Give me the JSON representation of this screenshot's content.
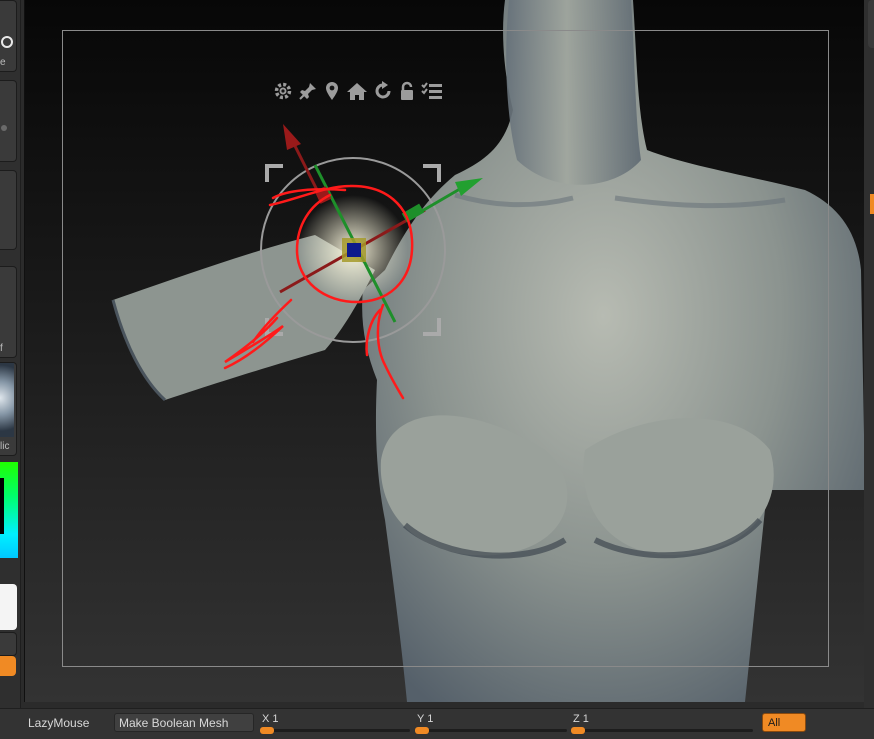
{
  "left_tray": {
    "labels": [
      "e",
      "f",
      "lic"
    ],
    "accent_color": "#f08a24"
  },
  "viewport": {
    "gizmo_toolbar": {
      "icons": [
        "gear-icon",
        "pin-icon",
        "location-marker-icon",
        "home-icon",
        "reset-rotate-icon",
        "lock-icon",
        "list-icon"
      ]
    },
    "gizmo_axes_colors": {
      "x": "#8b1a1a",
      "y": "#1e8f2a",
      "z": "#0d1a8c",
      "stroke_marks": "#ff1a1a"
    },
    "mesh": "female torso sculpt"
  },
  "bottom_bar": {
    "lazymouse_label": "LazyMouse",
    "boolean_button_label": "Make Boolean Mesh",
    "x_label": "X 1",
    "y_label": "Y 1",
    "z_label": "Z 1",
    "all_button_label": "All",
    "accent_color": "#f08a24"
  }
}
